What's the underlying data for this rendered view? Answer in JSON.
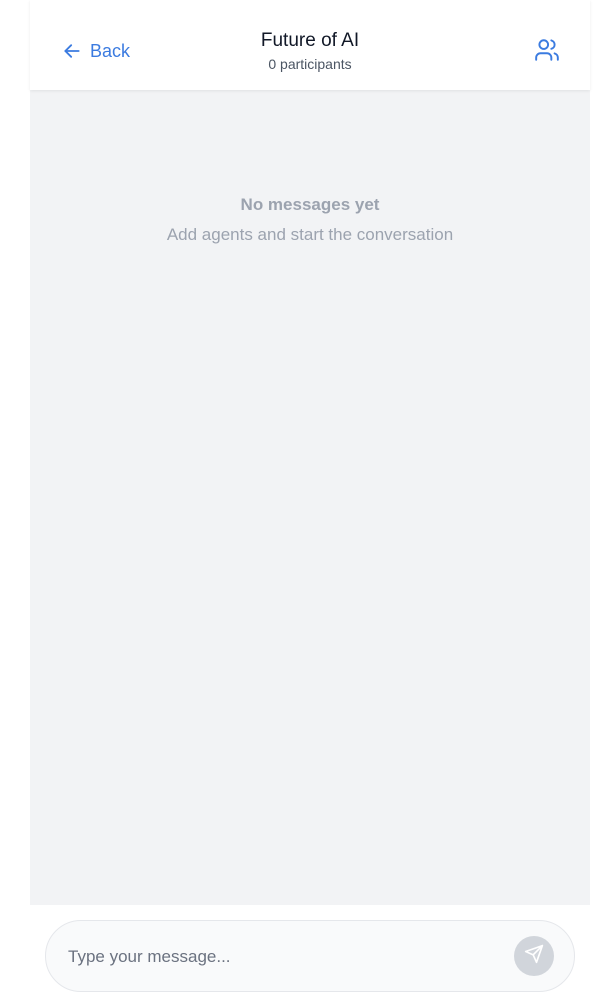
{
  "header": {
    "back_label": "Back",
    "title": "Future of AI",
    "subtitle": "0 participants",
    "back_icon": "arrow-left-icon",
    "participants_icon": "users-icon"
  },
  "messages": {
    "empty_title": "No messages yet",
    "empty_subtitle": "Add agents and start the conversation"
  },
  "composer": {
    "placeholder": "Type your message...",
    "value": "",
    "send_icon": "send-icon"
  },
  "colors": {
    "accent": "#3b7be0",
    "background": "#f2f3f5",
    "muted_text": "#9ca3af",
    "send_disabled": "#d1d5db"
  }
}
